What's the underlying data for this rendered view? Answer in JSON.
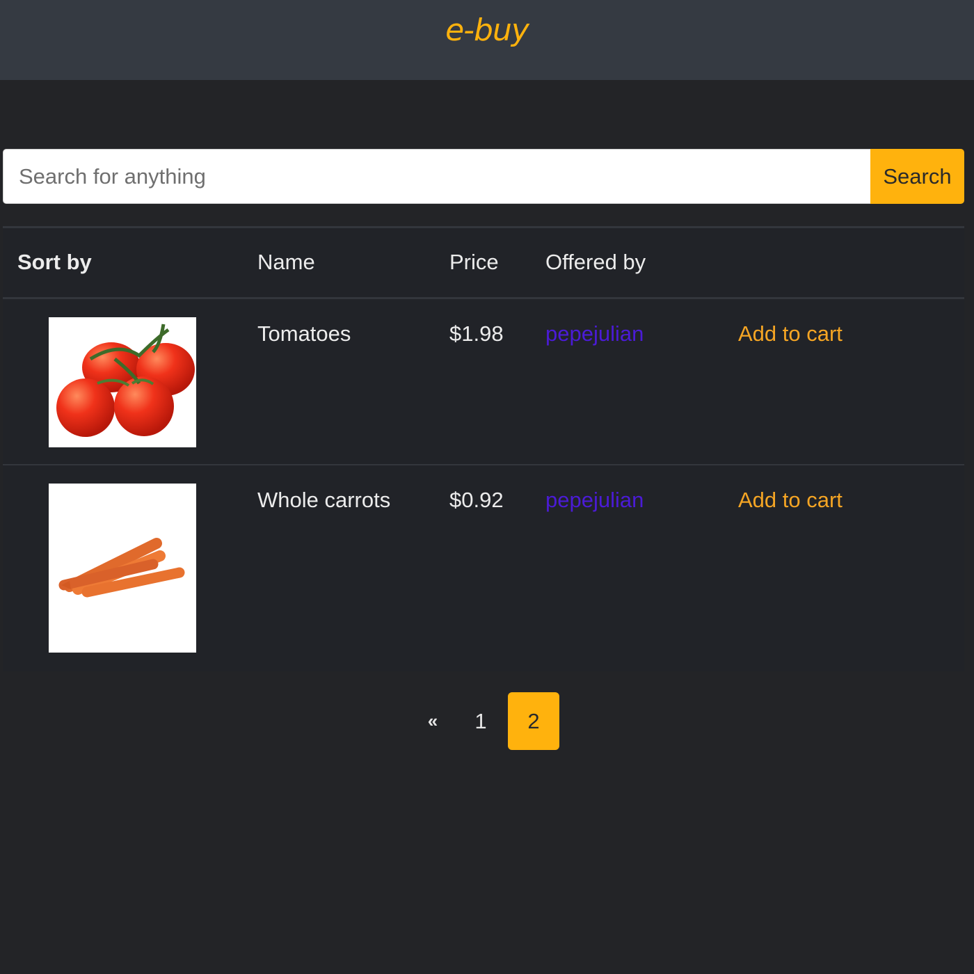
{
  "colors": {
    "accent": "#ffb20d",
    "vendor": "#4b1bd6",
    "cart": "#f5a524"
  },
  "header": {
    "brand": "e-buy"
  },
  "search": {
    "placeholder": "Search for anything",
    "button_label": "Search"
  },
  "table": {
    "headers": {
      "sort_by": "Sort by",
      "name": "Name",
      "price": "Price",
      "offered_by": "Offered by"
    },
    "rows": [
      {
        "image": "tomatoes-photo",
        "name": "Tomatoes",
        "price": "$1.98",
        "vendor": "pepejulian",
        "action": "Add to cart"
      },
      {
        "image": "carrots-photo",
        "name": "Whole carrots",
        "price": "$0.92",
        "vendor": "pepejulian",
        "action": "Add to cart"
      }
    ]
  },
  "pagination": {
    "prev": "«",
    "pages": [
      "1",
      "2"
    ],
    "current_page": "2"
  }
}
